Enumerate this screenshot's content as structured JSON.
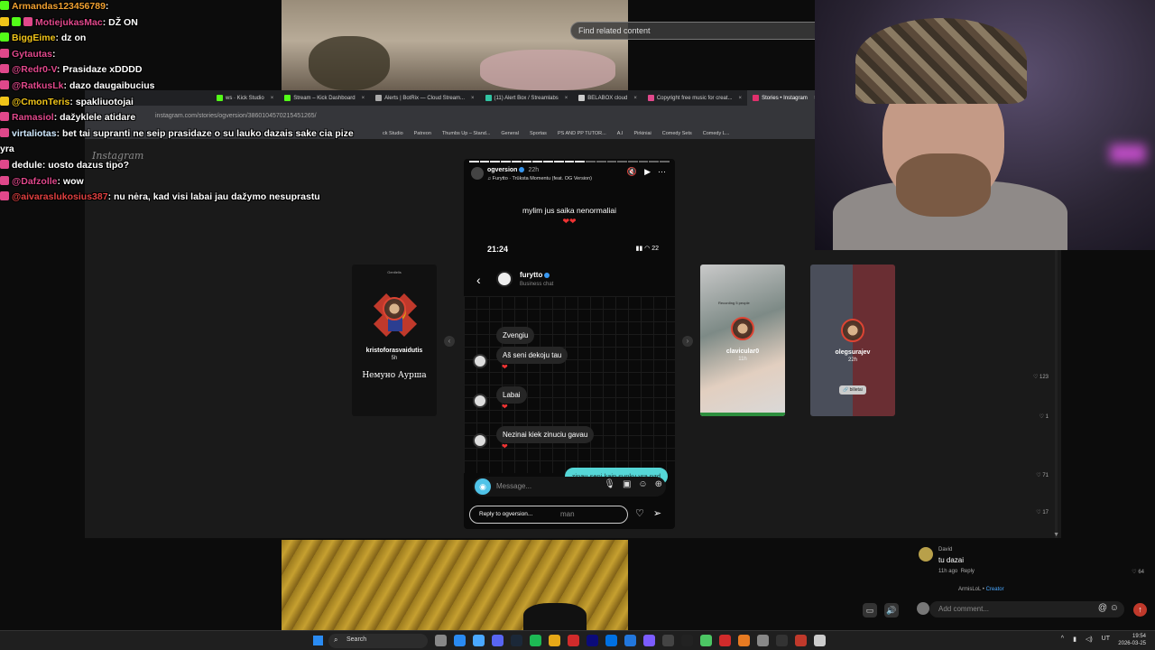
{
  "background_video": {
    "related_placeholder": "Find related content"
  },
  "browser": {
    "tabs": [
      {
        "label": "ws · Kick Studio",
        "active": false,
        "color": "#53fc18"
      },
      {
        "label": "Stream – Kick Dashboard",
        "active": false,
        "color": "#53fc18"
      },
      {
        "label": "Alerts | BotRix — Cloud Stream...",
        "active": false,
        "color": "#aaaaaa"
      },
      {
        "label": "(11) Alert Box / Streamlabs",
        "active": false,
        "color": "#31c3a2"
      },
      {
        "label": "BELABOX cloud",
        "active": false,
        "color": "#cccccc"
      },
      {
        "label": "Copyright free music for creat...",
        "active": false,
        "color": "#e0488b"
      },
      {
        "label": "Stories • Instagram",
        "active": true,
        "color": "#e1306c"
      }
    ],
    "address": "instagram.com/stories/ogversion/3860104570215451265/",
    "bookmarks": [
      "ck Studio",
      "Patreon",
      "Thumbs Up – Stand...",
      "General",
      "Sportas",
      "PS AND PP TUTOR...",
      "A.I",
      "Pirkiniai",
      "Comedy Sets",
      "Comedy L..."
    ]
  },
  "instagram": {
    "logo": "Instagram",
    "left_story": {
      "small_text": "Gentlelis",
      "username": "kristoforasvaidutis",
      "time": "5h",
      "title": "Немуно Ауршa"
    },
    "main_story": {
      "username": "ogversion",
      "time": "22h",
      "song": "♫ Furytto · Trūksta Momentu (feat. OG Version)",
      "caption": "mylim jus saika nenormaliai",
      "phone_time": "21:24",
      "battery": "22",
      "chat_name": "furytto",
      "chat_sub": "Business chat",
      "messages": [
        {
          "text": "Zvengiu",
          "from": "them",
          "avatar": false,
          "heart": false
        },
        {
          "text": "Aš seni dekoju tau",
          "from": "them",
          "avatar": true,
          "heart": true
        },
        {
          "text": "Labai",
          "from": "them",
          "avatar": true,
          "heart": true
        },
        {
          "text": "Nezinai kiek zinuciu gavau",
          "from": "them",
          "avatar": true,
          "heart": true
        },
        {
          "text": "zinau seni kaip sunku yra pzd",
          "from": "me",
          "avatar": false,
          "heart": false
        }
      ],
      "message_placeholder": "Message...",
      "reply_placeholder": "Reply to ogversion...",
      "reply_typed": "man"
    },
    "right_stories": [
      {
        "username": "clavicular0",
        "time": "11h",
        "overlay": "Recording 5 people"
      },
      {
        "username": "olegsurajev",
        "time": "22h",
        "badge": "🔗 bilietai"
      }
    ],
    "likes": [
      "123",
      "1",
      "71",
      "17",
      "64"
    ]
  },
  "chat_overlay": [
    {
      "user": "Armandas123456789",
      "text": "",
      "user_color": "#f0a030",
      "badges": [
        "bk"
      ]
    },
    {
      "user": "MotiejukasMac",
      "text": "DŽ ON",
      "user_color": "#e0488b",
      "badges": [
        "by",
        "bk",
        "bkp"
      ]
    },
    {
      "user": "BiggEime",
      "text": "dz on",
      "user_color": "#f0c419",
      "badges": [
        "bk"
      ]
    },
    {
      "user": "Gytautas",
      "text": "",
      "user_color": "#e0488b",
      "badges": [
        "bkp"
      ]
    },
    {
      "user": "@Redr0-V",
      "text": "Prasidaze xDDDD",
      "user_color": "#e0488b",
      "badges": [
        "bkp"
      ]
    },
    {
      "user": "@RatkusLk",
      "text": "dazo daugaibucius",
      "user_color": "#e0488b",
      "badges": [
        "bkp"
      ]
    },
    {
      "user": "@CmonTeris",
      "text": "spakliuotojai",
      "user_color": "#f0c419",
      "badges": [
        "by"
      ]
    },
    {
      "user": "Ramasiol",
      "text": "dažyklele atidare",
      "user_color": "#e0488b",
      "badges": [
        "bkp"
      ]
    },
    {
      "user": "virtaliotas",
      "text": "bet tai supranti ne seip prasidaze o su lauko dazais sake cia pize",
      "user_color": "#cfe9ff",
      "badges": [
        "bkp"
      ]
    },
    {
      "user": "",
      "text": "yra",
      "user_color": "#ffffff",
      "badges": []
    },
    {
      "user": "dedule",
      "text": "uosto dazus tipo?",
      "user_color": "#ffffff",
      "badges": [
        "bkp"
      ]
    },
    {
      "user": "@Dafzolle",
      "text": "wow",
      "user_color": "#e0488b",
      "badges": [
        "bkp"
      ]
    },
    {
      "user": "@aivaraslukosius387",
      "text": "nu nėra, kad visi labai jau dažymo nesuprastu",
      "user_color": "#e04040",
      "badges": [
        "bkp"
      ]
    }
  ],
  "comments": {
    "author": "David",
    "text": "tu dazai",
    "time": "11h ago",
    "reply": "Reply",
    "likes": "64",
    "sub_author": "ArmisLoL",
    "sub_role": "Creator",
    "add_placeholder": "Add comment..."
  },
  "taskbar": {
    "search": "Search",
    "lang": "UT",
    "time": "19:54",
    "date": "2026-03-25",
    "icon_colors": [
      "#888",
      "#2a8bf2",
      "#4aa8ff",
      "#5865f2",
      "#1b2838",
      "#1db954",
      "#e6a817",
      "#d12b2b",
      "#0b0b7a",
      "#0071e3",
      "#2277dd",
      "#7c5cff",
      "#444",
      "#222",
      "#4cc764",
      "#d12b2b",
      "#e77b22",
      "#888",
      "#333",
      "#c0392b",
      "#ccc"
    ]
  }
}
